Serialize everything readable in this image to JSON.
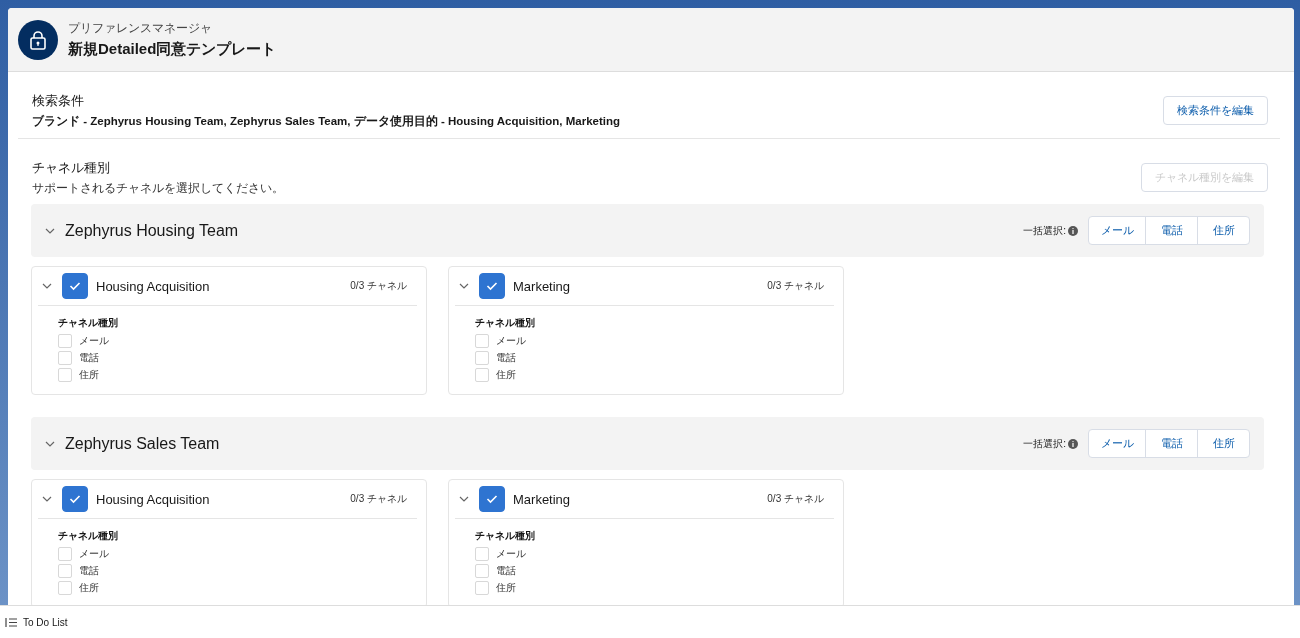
{
  "header": {
    "subtitle": "プリファレンスマネージャ",
    "title": "新規Detailed同意テンプレート"
  },
  "filter": {
    "label": "検索条件",
    "text": "ブランド - Zephyrus Housing Team, Zephyrus Sales Team, データ使用目的 - Housing Acquisition, Marketing",
    "edit_button": {
      "label": "検索条件を編集",
      "disabled": false
    }
  },
  "channels": {
    "label": "チャネル種別",
    "hint": "サポートされるチャネルを選択してください。",
    "edit_button": {
      "label": "チャネル種別を編集",
      "disabled": true
    }
  },
  "brands": [
    {
      "name": "Zephyrus Housing Team",
      "expanded": true,
      "bulk_label": "一括選択:",
      "bulk_buttons": [
        "メール",
        "電話",
        "住所"
      ],
      "purposes": [
        {
          "name": "Housing Acquisition",
          "checked": true,
          "expanded": true,
          "count": "0/3 チャネル",
          "group_label": "チャネル種別",
          "options": [
            {
              "label": "メール",
              "checked": false
            },
            {
              "label": "電話",
              "checked": false
            },
            {
              "label": "住所",
              "checked": false
            }
          ]
        },
        {
          "name": "Marketing",
          "checked": true,
          "expanded": true,
          "count": "0/3 チャネル",
          "group_label": "チャネル種別",
          "options": [
            {
              "label": "メール",
              "checked": false
            },
            {
              "label": "電話",
              "checked": false
            },
            {
              "label": "住所",
              "checked": false
            }
          ]
        }
      ]
    },
    {
      "name": "Zephyrus Sales Team",
      "expanded": true,
      "bulk_label": "一括選択:",
      "bulk_buttons": [
        "メール",
        "電話",
        "住所"
      ],
      "purposes": [
        {
          "name": "Housing Acquisition",
          "checked": true,
          "expanded": true,
          "count": "0/3 チャネル",
          "group_label": "チャネル種別",
          "options": [
            {
              "label": "メール",
              "checked": false
            },
            {
              "label": "電話",
              "checked": false
            },
            {
              "label": "住所",
              "checked": false
            }
          ]
        },
        {
          "name": "Marketing",
          "checked": true,
          "expanded": true,
          "count": "0/3 チャネル",
          "group_label": "チャネル種別",
          "options": [
            {
              "label": "メール",
              "checked": false
            },
            {
              "label": "電話",
              "checked": false
            },
            {
              "label": "住所",
              "checked": false
            }
          ]
        }
      ]
    }
  ],
  "footer": {
    "label": "To Do List"
  }
}
